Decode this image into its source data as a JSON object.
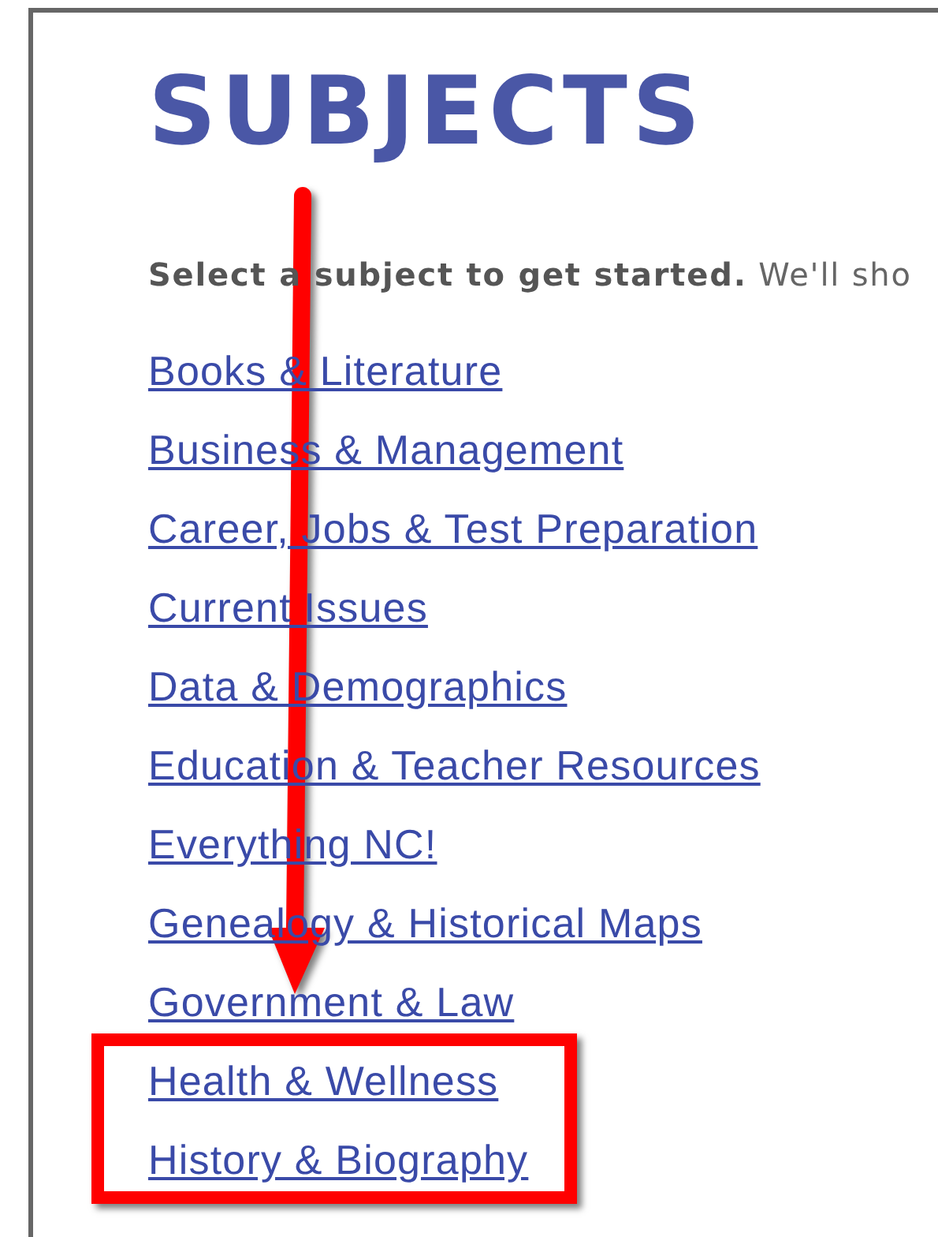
{
  "heading": "SUBJECTS",
  "intro": "**Select a subject to get started.** We'll sho",
  "subjects": [
    "Books & Literature",
    "Business & Management",
    "Career, Jobs & Test Preparation",
    "Current Issues",
    "Data & Demographics",
    "Education & Teacher Resources",
    "Everything NC!",
    "Genealogy & Historical Maps",
    "Government & Law",
    "Health & Wellness",
    "History & Biography"
  ]
}
